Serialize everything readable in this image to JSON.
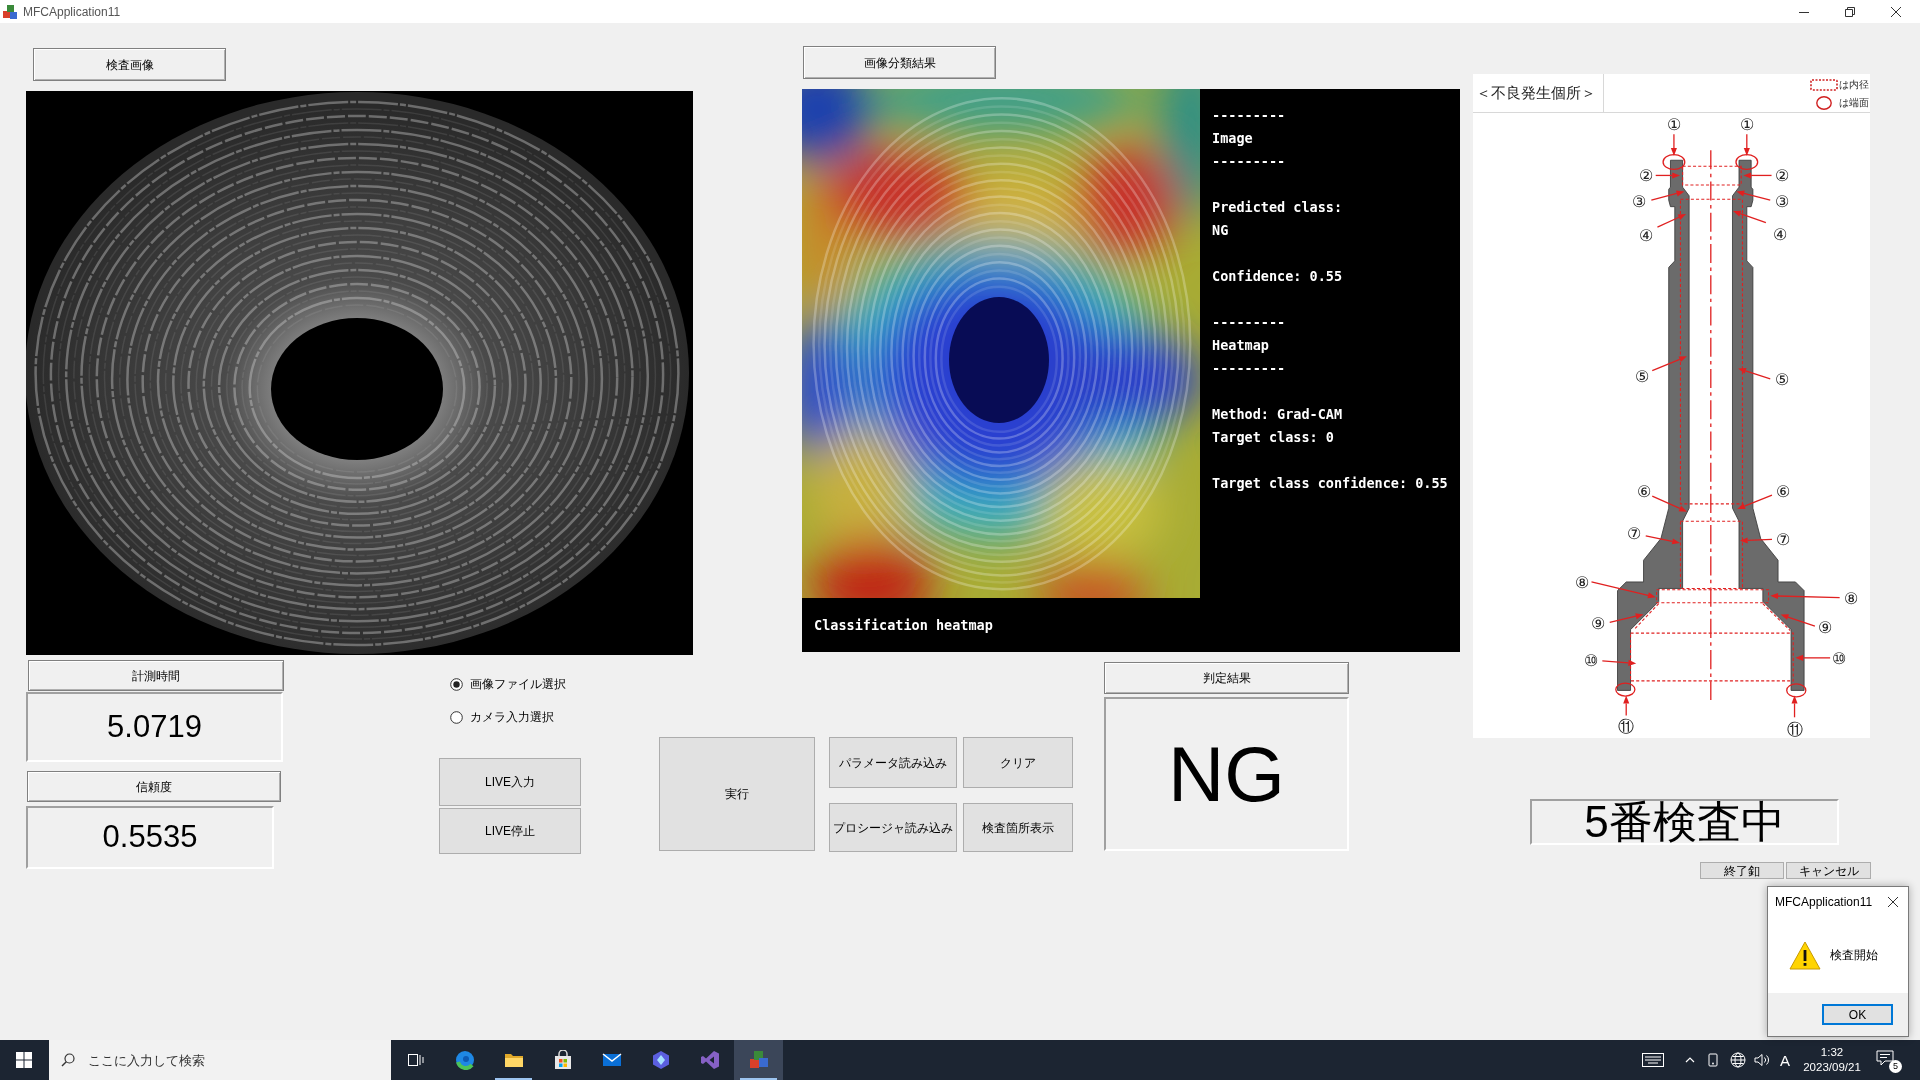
{
  "window": {
    "title": "MFCApplication11"
  },
  "inspection_image": {
    "label": "検査画像"
  },
  "classification": {
    "label": "画像分類結果",
    "text_blocks": [
      [
        "---------",
        "Image",
        "---------"
      ],
      [
        "Predicted class:",
        "NG"
      ],
      [
        "Confidence: 0.55"
      ],
      [
        "---------",
        "Heatmap",
        "---------"
      ],
      [
        "Method: Grad-CAM",
        "Target class: 0"
      ],
      [
        "Target class confidence: 0.55"
      ]
    ],
    "caption": "Classification heatmap"
  },
  "defect_locations": {
    "title": "＜不良発生個所＞",
    "legend": [
      {
        "kind": "dotted-rect",
        "text": "は内径"
      },
      {
        "kind": "circle",
        "text": "は端面"
      }
    ],
    "callouts": [
      "①",
      "①",
      "②",
      "②",
      "③",
      "③",
      "④",
      "④",
      "⑤",
      "⑤",
      "⑥",
      "⑥",
      "⑦",
      "⑦",
      "⑧",
      "⑧",
      "⑨",
      "⑨",
      "⑩",
      "⑩",
      "⑪",
      "⑪"
    ]
  },
  "measurements": [
    {
      "label": "計測時間",
      "value": "5.0719"
    },
    {
      "label": "信頼度",
      "value": "0.5535"
    }
  ],
  "input_mode": [
    {
      "label": "画像ファイル選択",
      "selected": true
    },
    {
      "label": "カメラ入力選択",
      "selected": false
    }
  ],
  "live_buttons": [
    "LIVE入力",
    "LIVE停止"
  ],
  "run_button": "実行",
  "action_buttons": [
    "パラメータ読み込み",
    "クリア",
    "プロシージャ読み込み",
    "検査箇所表示"
  ],
  "judgement": {
    "label": "判定結果",
    "value": "NG"
  },
  "status": "5番検査中",
  "end_buttons": [
    "終了釦",
    "キャンセル"
  ],
  "dialog": {
    "title": "MFCApplication11",
    "message": "検査開始",
    "button": "OK"
  },
  "taskbar": {
    "search": {
      "placeholder": "ここに入力して検索"
    },
    "apps": [
      {
        "running": false,
        "selected": false
      },
      {
        "running": true,
        "selected": false
      },
      {
        "running": false,
        "selected": false
      },
      {
        "running": false,
        "selected": false
      },
      {
        "running": false,
        "selected": false
      },
      {
        "running": false,
        "selected": false
      },
      {
        "running": true,
        "selected": true
      }
    ],
    "ime_mode": "A",
    "time": "1:32",
    "date": "2023/09/21",
    "notification_count": "5"
  }
}
